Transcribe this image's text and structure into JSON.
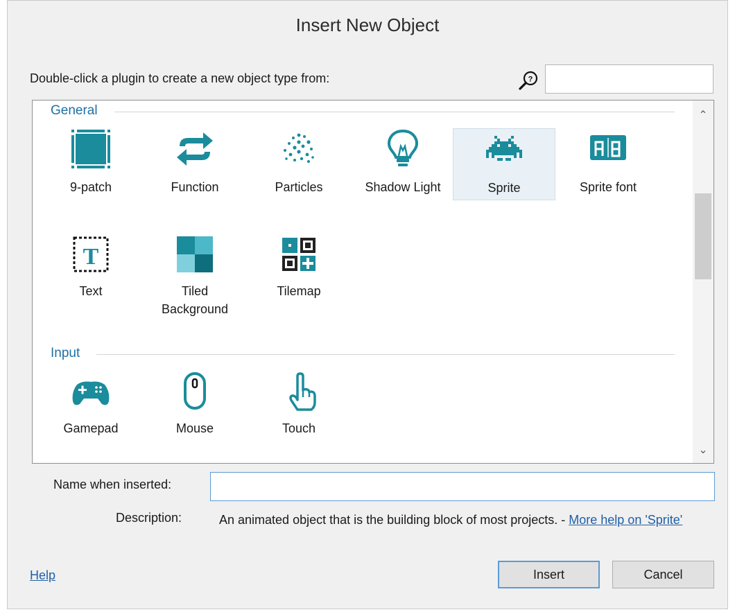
{
  "dialog": {
    "title": "Insert New Object",
    "instruction": "Double-click a plugin to create a new object type from:",
    "search": {
      "value": "",
      "icon": "search-icon"
    }
  },
  "groups": [
    {
      "label": "General",
      "items": [
        {
          "label": "9-patch",
          "icon": "nine-patch-icon"
        },
        {
          "label": "Function",
          "icon": "function-icon"
        },
        {
          "label": "Particles",
          "icon": "particles-icon"
        },
        {
          "label": "Shadow Light",
          "icon": "shadow-light-icon"
        },
        {
          "label": "Sprite",
          "icon": "sprite-icon",
          "selected": true
        },
        {
          "label": "Sprite font",
          "icon": "sprite-font-icon"
        },
        {
          "label": "Text",
          "icon": "text-icon"
        },
        {
          "label": "Tiled Background",
          "icon": "tiled-background-icon"
        },
        {
          "label": "Tilemap",
          "icon": "tilemap-icon"
        }
      ]
    },
    {
      "label": "Input",
      "items": [
        {
          "label": "Gamepad",
          "icon": "gamepad-icon"
        },
        {
          "label": "Mouse",
          "icon": "mouse-icon"
        },
        {
          "label": "Touch",
          "icon": "touch-icon"
        }
      ]
    }
  ],
  "name_field": {
    "label": "Name when inserted:",
    "value": ""
  },
  "description": {
    "label": "Description:",
    "text": "An animated object that is the building block of most projects. - ",
    "link": "More help on 'Sprite'"
  },
  "footer": {
    "help_link": "Help",
    "insert_label": "Insert",
    "cancel_label": "Cancel"
  },
  "colors": {
    "accent": "#1a8c9c",
    "link": "#1f5fa8",
    "focus": "#5b9bd5"
  }
}
